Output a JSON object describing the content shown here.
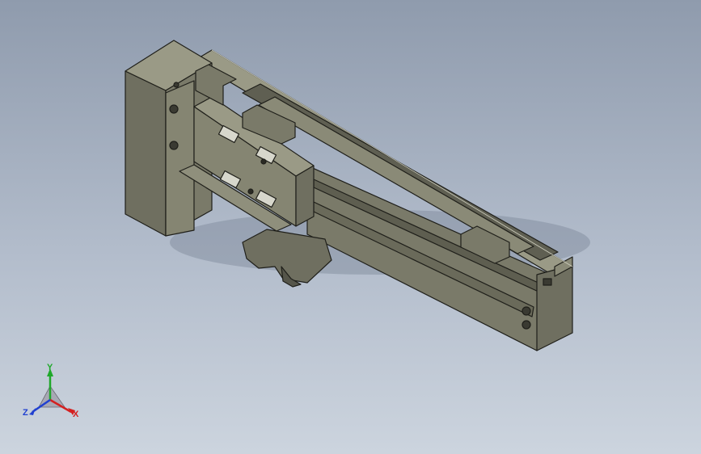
{
  "viewport": {
    "background_top": "#8f9bad",
    "background_bottom": "#ccd4de"
  },
  "model": {
    "description_icon": "linear-actuator-3d-model",
    "body_color": "#7a7a69",
    "shade_dark": "#4f4f43",
    "shade_light": "#9a9a86",
    "edge_color": "#1f1f1a"
  },
  "triad": {
    "x_label": "X",
    "y_label": "Y",
    "z_label": "Z",
    "x_color": "#d42020",
    "y_color": "#1fa82a",
    "z_color": "#2040d0"
  }
}
